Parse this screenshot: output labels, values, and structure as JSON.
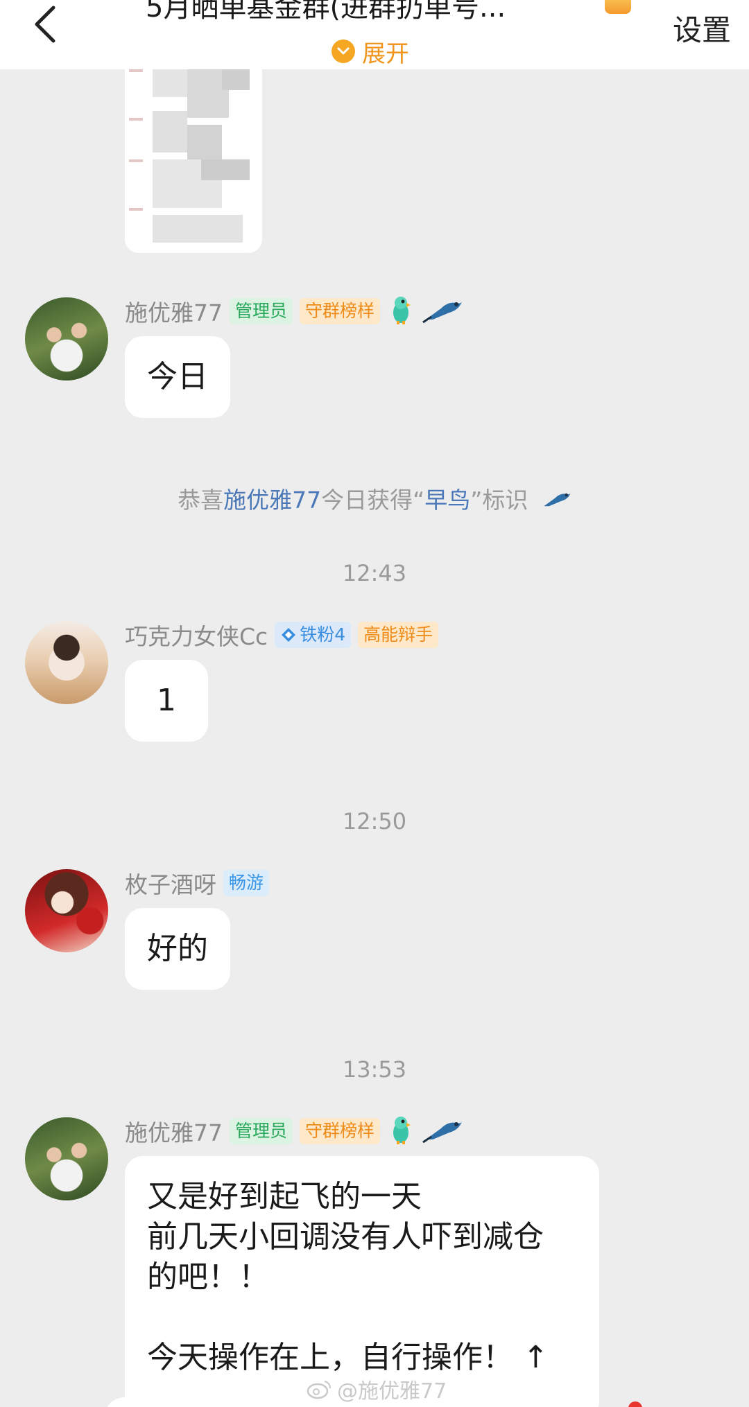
{
  "header": {
    "title": "5月晒单基金群(进群扔单号...",
    "expand_label": "展开",
    "settings_label": "设置"
  },
  "messages": [
    {
      "sender": "施优雅77",
      "tags": [
        "管理员",
        "守群榜样"
      ],
      "text": "今日"
    },
    {
      "sender": "巧克力女侠Cc",
      "tags": [
        "铁粉4",
        "高能辩手"
      ],
      "text": "1"
    },
    {
      "sender": "枚子酒呀",
      "tags": [
        "畅游"
      ],
      "text": "好的"
    },
    {
      "sender": "施优雅77",
      "tags": [
        "管理员",
        "守群榜样"
      ],
      "lines": [
        "又是好到起飞的一天",
        "前几天小回调没有人吓到减仓",
        "的吧！！",
        "",
        "今天操作在上，自行操作！ ↑"
      ]
    }
  ],
  "system": {
    "prefix": "恭喜",
    "name": "施优雅77",
    "middle": "今日获得“",
    "badge": "早鸟",
    "suffix": "”标识"
  },
  "times": [
    "12:43",
    "12:50",
    "13:53"
  ],
  "watermark": "@施优雅77"
}
